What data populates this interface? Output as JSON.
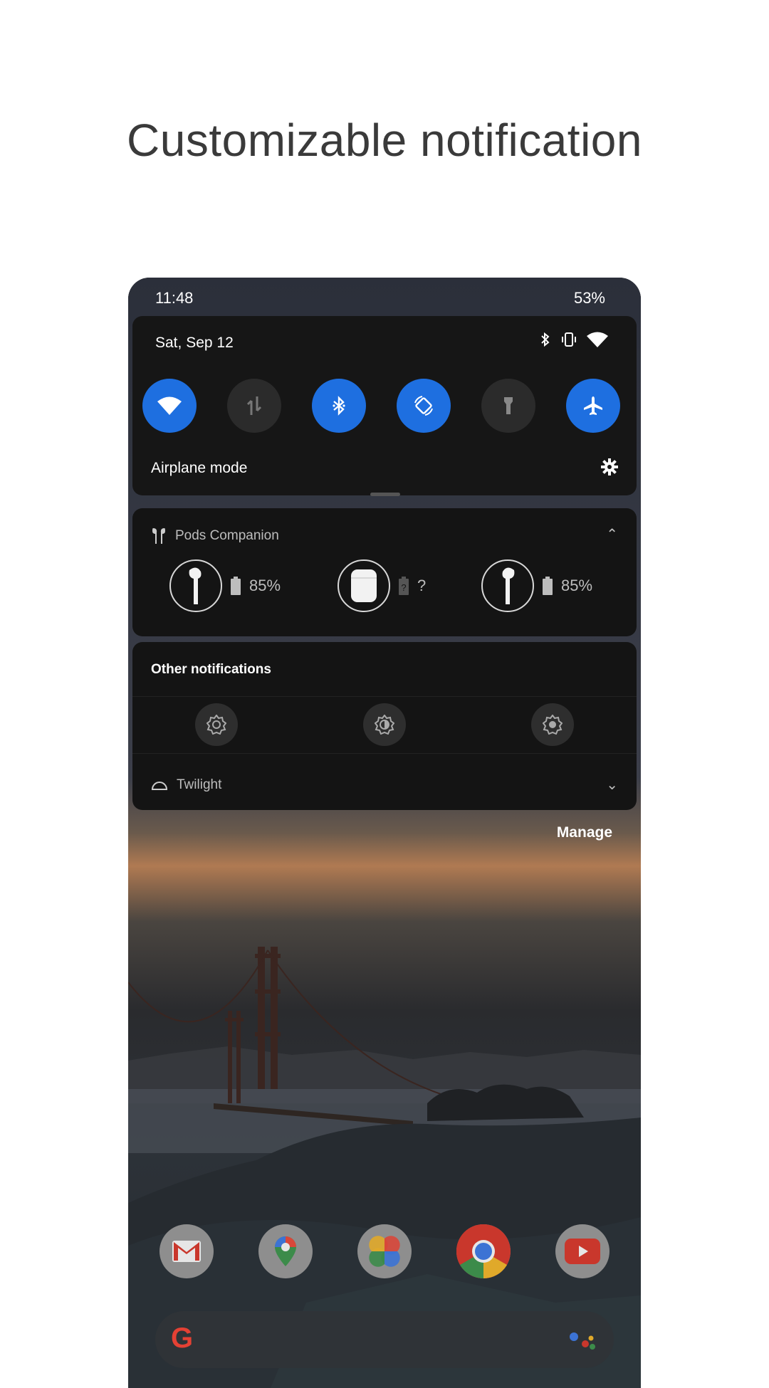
{
  "headline": "Customizable notification",
  "status_bar": {
    "time": "11:48",
    "battery": "53%"
  },
  "quick_settings": {
    "date": "Sat, Sep 12",
    "tiles": [
      {
        "name": "wifi",
        "state": "on"
      },
      {
        "name": "mobile-data",
        "state": "off"
      },
      {
        "name": "bluetooth",
        "state": "on"
      },
      {
        "name": "auto-rotate",
        "state": "on"
      },
      {
        "name": "flashlight",
        "state": "off"
      },
      {
        "name": "airplane-mode",
        "state": "on"
      }
    ],
    "label": "Airplane mode"
  },
  "pods_notification": {
    "app_name": "Pods Companion",
    "left_level": "85%",
    "case_level": "?",
    "right_level": "85%"
  },
  "other_notifications": {
    "title": "Other notifications",
    "twilight_label": "Twilight"
  },
  "manage_label": "Manage",
  "dock_apps": [
    "gmail-icon",
    "maps-icon",
    "photos-icon",
    "chrome-icon",
    "youtube-icon"
  ],
  "colors": {
    "accent": "#1e6fe0",
    "panel": "#161616",
    "card": "#141414"
  }
}
